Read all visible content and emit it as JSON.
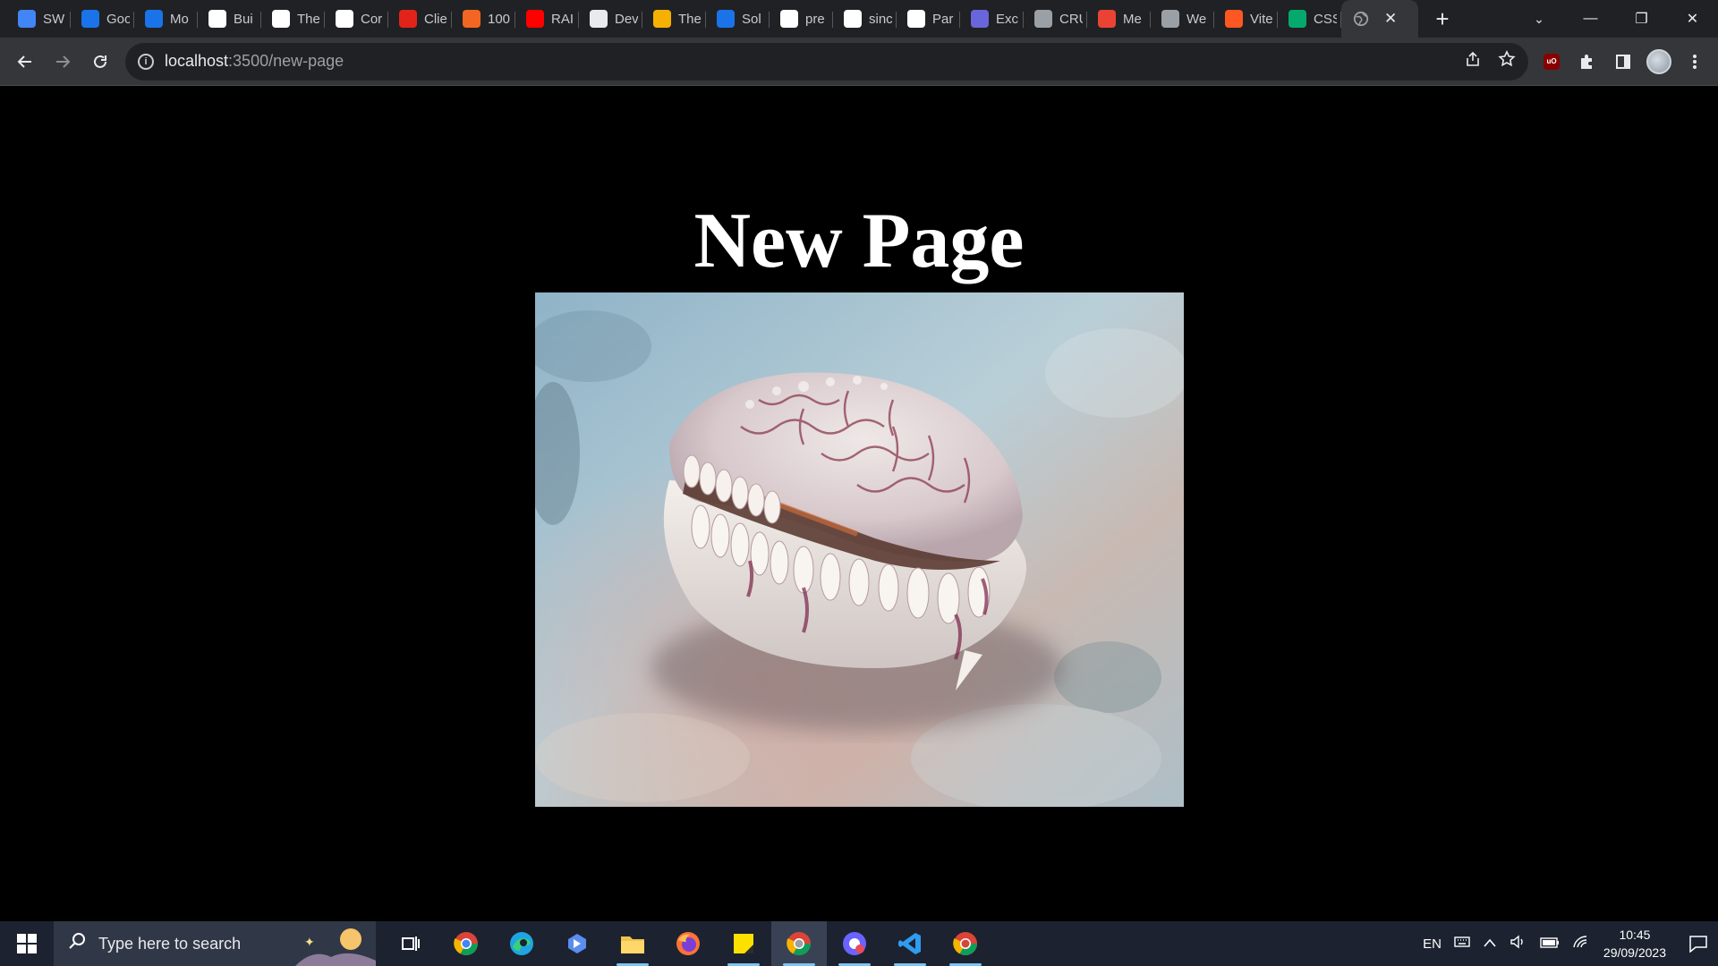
{
  "browser": {
    "tabs": [
      {
        "label": "SW",
        "icon": "google-docs-icon",
        "color": "#4285f4"
      },
      {
        "label": "Goo",
        "icon": "google-calendar-icon",
        "color": "#1a73e8"
      },
      {
        "label": "Mo",
        "icon": "google-contacts-icon",
        "color": "#1a73e8"
      },
      {
        "label": "Bui",
        "icon": "stairs-icon",
        "color": "#ffffff"
      },
      {
        "label": "The",
        "icon": "stairs-icon",
        "color": "#ffffff"
      },
      {
        "label": "Cor",
        "icon": "m-logo-icon",
        "color": "#ffffff"
      },
      {
        "label": "Clie",
        "icon": "w-logo-icon",
        "color": "#e2231a"
      },
      {
        "label": "100",
        "icon": "orange-dots-icon",
        "color": "#f26522"
      },
      {
        "label": "RAI",
        "icon": "youtube-icon",
        "color": "#ff0000"
      },
      {
        "label": "Dev",
        "icon": "search-box-icon",
        "color": "#e8eaed"
      },
      {
        "label": "The",
        "icon": "yellow-hand-icon",
        "color": "#f6b100"
      },
      {
        "label": "Sol",
        "icon": "infinity-icon",
        "color": "#1a73e8"
      },
      {
        "label": "pre",
        "icon": "github-icon",
        "color": "#ffffff"
      },
      {
        "label": "sinc",
        "icon": "github-icon",
        "color": "#ffffff"
      },
      {
        "label": "Par",
        "icon": "stairs-icon",
        "color": "#ffffff"
      },
      {
        "label": "Exc",
        "icon": "excalidraw-icon",
        "color": "#6965db"
      },
      {
        "label": "CRU",
        "icon": "globe-icon",
        "color": "#9aa0a6"
      },
      {
        "label": "Me",
        "icon": "colorful-m-icon",
        "color": "#ea4335"
      },
      {
        "label": "We",
        "icon": "globe-icon",
        "color": "#9aa0a6"
      },
      {
        "label": "Vite",
        "icon": "bug-icon",
        "color": "#ff5722"
      },
      {
        "label": "CSS",
        "icon": "w3schools-icon",
        "color": "#04aa6d"
      }
    ],
    "active_tab": {
      "label": "",
      "icon": "globe-icon",
      "close": "✕"
    },
    "new_tab": "+",
    "tab_search": "⌄",
    "window_controls": {
      "minimize": "—",
      "restore": "❐",
      "close": "✕"
    },
    "address": {
      "host": "localhost",
      "path": ":3500/new-page",
      "info": "i"
    }
  },
  "page": {
    "title": "New Page",
    "image_subject": "cowrie shell on sand"
  },
  "taskbar": {
    "search_placeholder": "Type here to search",
    "language": "EN",
    "time": "10:45",
    "date": "29/09/2023"
  }
}
